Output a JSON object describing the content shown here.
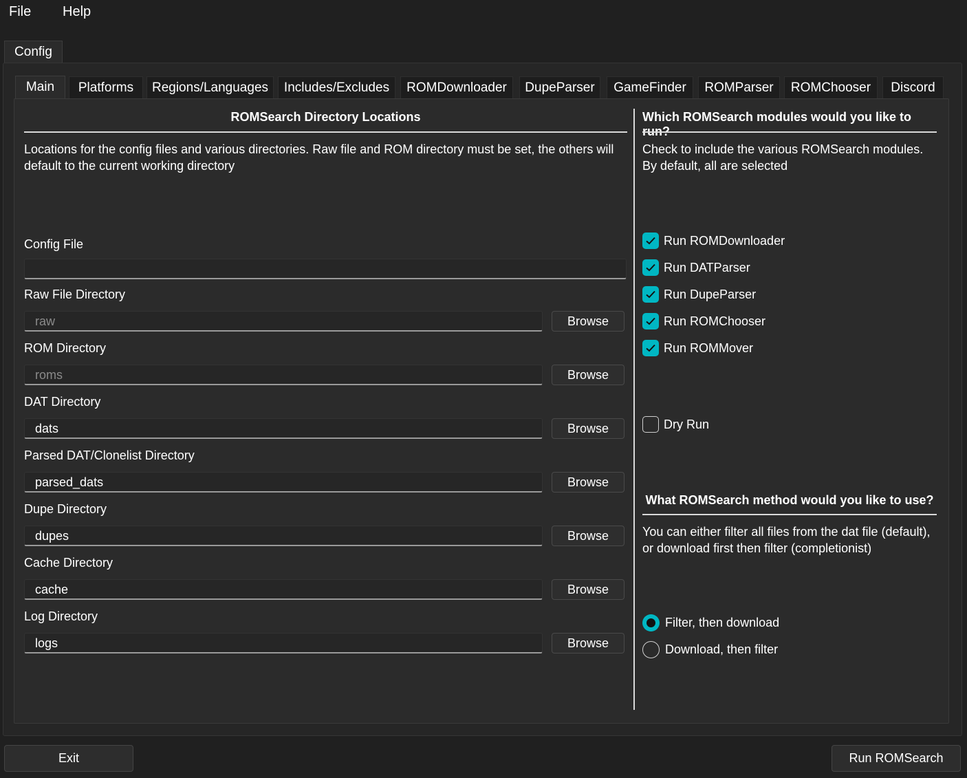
{
  "menu": {
    "file": "File",
    "help": "Help"
  },
  "outer_tab": "Config",
  "tabs": [
    "Main",
    "Platforms",
    "Regions/Languages",
    "Includes/Excludes",
    "ROMDownloader",
    "DupeParser",
    "GameFinder",
    "ROMParser",
    "ROMChooser",
    "Discord"
  ],
  "left": {
    "heading": "ROMSearch Directory Locations",
    "description": "Locations for the config files and various directories. Raw file and ROM directory must be set, the others will default to the current working directory",
    "config_file": {
      "label": "Config File",
      "value": ""
    },
    "fields": [
      {
        "label": "Raw File Directory",
        "value": "",
        "placeholder": "raw",
        "button": "Browse"
      },
      {
        "label": "ROM Directory",
        "value": "",
        "placeholder": "roms",
        "button": "Browse"
      },
      {
        "label": "DAT Directory",
        "value": "dats",
        "placeholder": "",
        "button": "Browse"
      },
      {
        "label": "Parsed DAT/Clonelist Directory",
        "value": "parsed_dats",
        "placeholder": "",
        "button": "Browse"
      },
      {
        "label": "Dupe Directory",
        "value": "dupes",
        "placeholder": "",
        "button": "Browse"
      },
      {
        "label": "Cache Directory",
        "value": "cache",
        "placeholder": "",
        "button": "Browse"
      },
      {
        "label": "Log Directory",
        "value": "logs",
        "placeholder": "",
        "button": "Browse"
      }
    ]
  },
  "right": {
    "modules_heading": "Which ROMSearch modules would you like to run?",
    "modules_description": "Check to include the various ROMSearch modules. By default, all are selected",
    "modules": [
      {
        "label": "Run ROMDownloader",
        "checked": true
      },
      {
        "label": "Run DATParser",
        "checked": true
      },
      {
        "label": "Run DupeParser",
        "checked": true
      },
      {
        "label": "Run ROMChooser",
        "checked": true
      },
      {
        "label": "Run ROMMover",
        "checked": true
      }
    ],
    "dry_run": {
      "label": "Dry Run",
      "checked": false
    },
    "method_heading": "What ROMSearch method would you like to use?",
    "method_description": "You can either filter all files from the dat file (default), or download first then filter (completionist)",
    "methods": [
      {
        "label": "Filter, then download",
        "selected": true
      },
      {
        "label": "Download, then filter",
        "selected": false
      }
    ]
  },
  "footer": {
    "exit": "Exit",
    "run": "Run ROMSearch"
  },
  "colors": {
    "accent": "#00b7c3",
    "background": "#202020",
    "panel": "#2b2b2b"
  }
}
